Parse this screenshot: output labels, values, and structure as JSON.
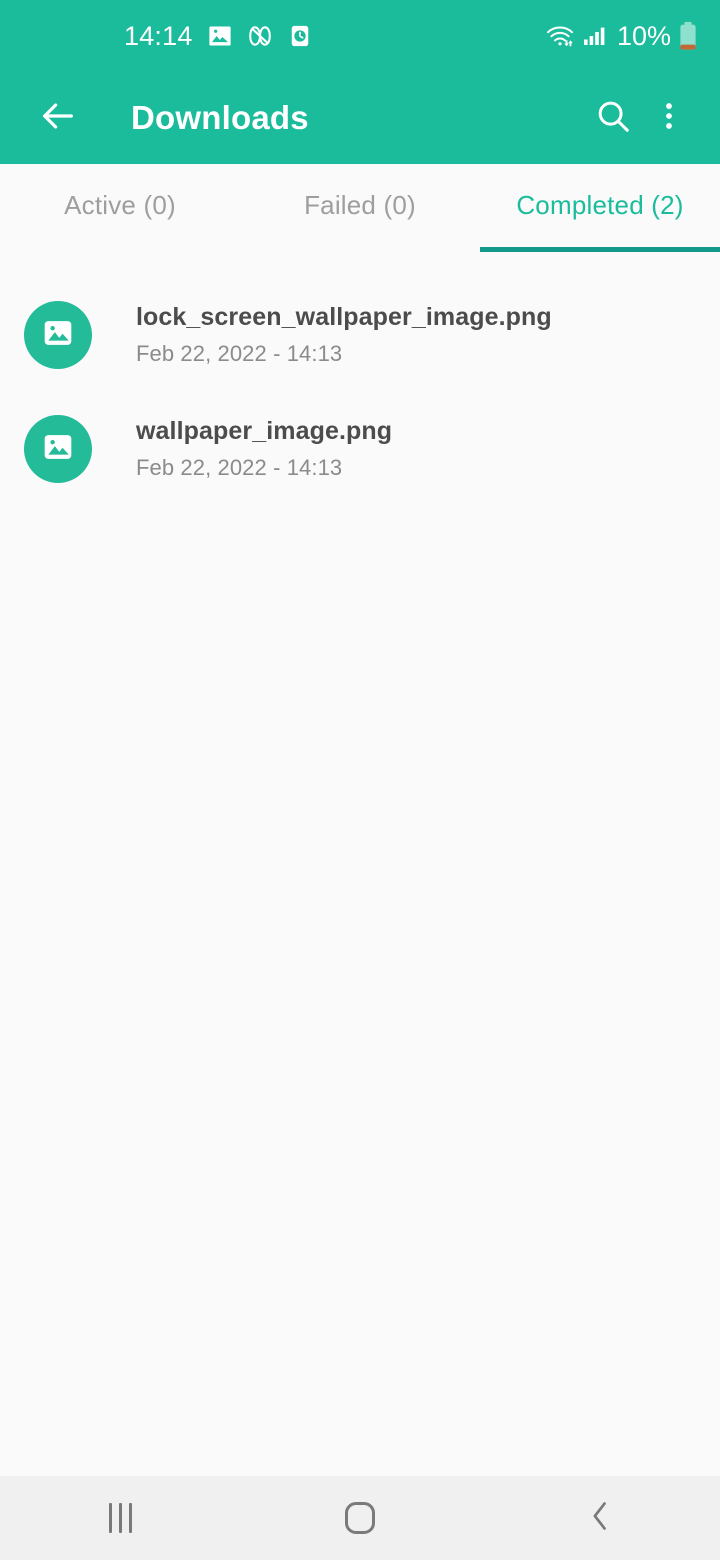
{
  "theme": {
    "accent": "#1ABC9C",
    "accent_dark": "#12998C",
    "avatar": "#24BB98",
    "background": "#fafafa",
    "navbar": "#f0f0f0",
    "title_text": "#4c4c4c",
    "subtitle_text": "#8b8b8b",
    "tab_inactive": "#9e9e9e",
    "battery_low": "#C2693A"
  },
  "status_bar": {
    "time": "14:14",
    "left_icons": [
      "image-icon",
      "dual-audio-icon",
      "alarm-icon"
    ],
    "right_icons": [
      "wifi-icon",
      "signal-icon"
    ],
    "battery_level": "10%",
    "battery_icon": "battery-low-icon"
  },
  "app_bar": {
    "back_icon": "arrow-back-icon",
    "title": "Downloads",
    "search_icon": "search-icon",
    "overflow_icon": "more-vert-icon"
  },
  "tabs": [
    {
      "label": "Active (0)",
      "name": "tab-active",
      "active": false
    },
    {
      "label": "Failed (0)",
      "name": "tab-failed",
      "active": false
    },
    {
      "label": "Completed (2)",
      "name": "tab-completed",
      "active": true
    }
  ],
  "downloads": [
    {
      "icon": "image-file-icon",
      "filename": "lock_screen_wallpaper_image.png",
      "date": "Feb 22, 2022 - 14:13"
    },
    {
      "icon": "image-file-icon",
      "filename": "wallpaper_image.png",
      "date": "Feb 22, 2022 - 14:13"
    }
  ],
  "nav_bar": {
    "recents": "recents-icon",
    "home": "home-icon",
    "back": "back-icon"
  }
}
